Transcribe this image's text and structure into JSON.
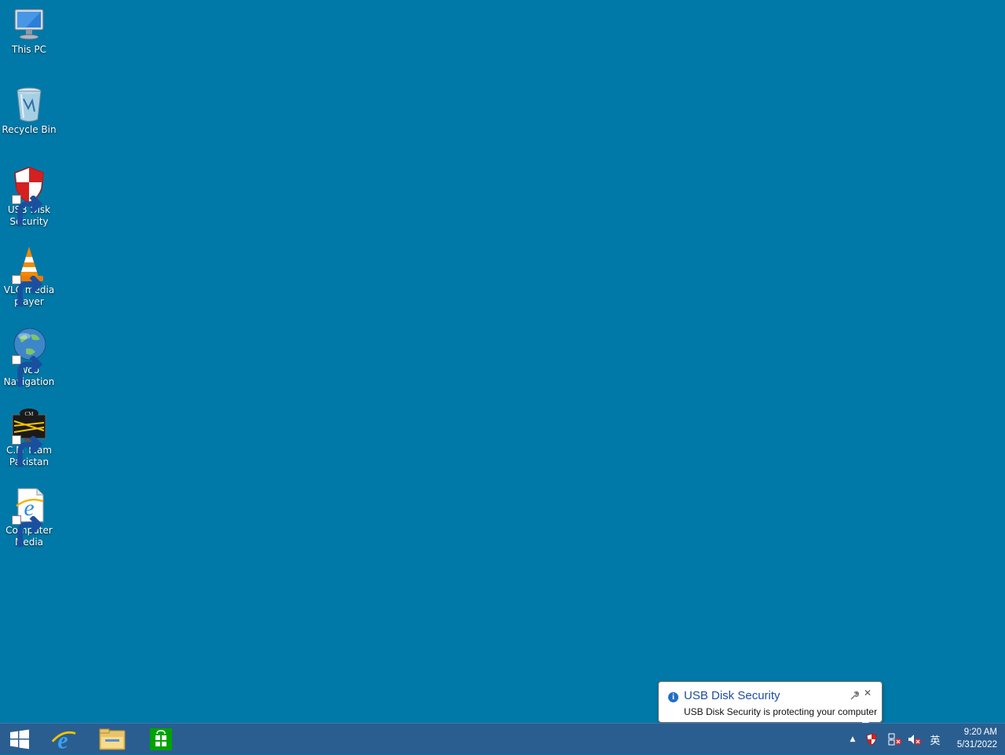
{
  "desktop": {
    "background_color": "#0079a8",
    "icons": [
      {
        "label": "This PC",
        "icon": "computer-icon",
        "shortcut": false
      },
      {
        "label": "Recycle Bin",
        "icon": "recycle-bin-icon",
        "shortcut": false
      },
      {
        "label": "USB Disk Security",
        "icon": "shield-icon",
        "shortcut": true
      },
      {
        "label": "VLC media player",
        "icon": "vlc-cone-icon",
        "shortcut": true
      },
      {
        "label": "Web Navigation",
        "icon": "globe-icon",
        "shortcut": true
      },
      {
        "label": "C.M Team Pakistan",
        "icon": "cm-team-icon",
        "shortcut": true
      },
      {
        "label": "Computer Media",
        "icon": "internet-explorer-icon",
        "shortcut": true
      }
    ]
  },
  "taskbar": {
    "color": "#2a5e90",
    "pinned": [
      {
        "name": "start-button",
        "icon": "windows-logo-icon"
      },
      {
        "name": "internet-explorer",
        "icon": "internet-explorer-icon"
      },
      {
        "name": "file-explorer",
        "icon": "folder-icon"
      },
      {
        "name": "store",
        "icon": "store-icon"
      }
    ],
    "tray": {
      "show_hidden": "▲",
      "ime": "英",
      "time": "9:20 AM",
      "date": "5/31/2022"
    }
  },
  "notification": {
    "title": "USB Disk Security",
    "message": "USB Disk Security is protecting your computer",
    "close_glyph": "✕"
  }
}
